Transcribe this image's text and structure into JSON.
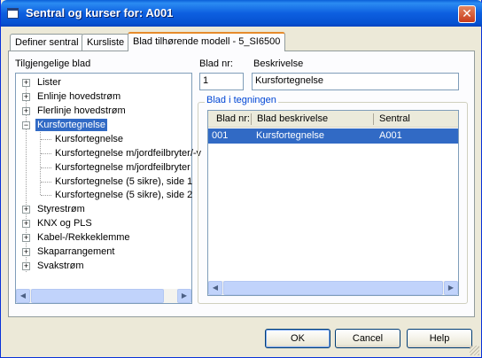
{
  "window": {
    "title": "Sentral og kurser for: A001",
    "close_glyph": "✕"
  },
  "tabs": [
    {
      "label": "Definer sentral"
    },
    {
      "label": "Kursliste"
    },
    {
      "label": "Blad tilhørende modell - 5_SI6500",
      "active": true
    }
  ],
  "left": {
    "label": "Tilgjengelige blad",
    "tree": [
      {
        "label": "Lister",
        "expander": "+"
      },
      {
        "label": "Enlinje hovedstrøm",
        "expander": "+"
      },
      {
        "label": "Flerlinje hovedstrøm",
        "expander": "+"
      },
      {
        "label": "Kursfortegnelse",
        "expander": "−",
        "selected": true
      },
      {
        "label": "Kursfortegnelse",
        "child": true
      },
      {
        "label": "Kursfortegnelse m/jordfeilbryter/-v",
        "child": true
      },
      {
        "label": "Kursfortegnelse m/jordfeilbryter",
        "child": true
      },
      {
        "label": "Kursfortegnelse (5 sikre), side 1",
        "child": true
      },
      {
        "label": "Kursfortegnelse (5 sikre), side 2",
        "child": true
      },
      {
        "label": "Styrestrøm",
        "expander": "+"
      },
      {
        "label": "KNX og PLS",
        "expander": "+"
      },
      {
        "label": "Kabel-/Rekkeklemme",
        "expander": "+"
      },
      {
        "label": "Skaparrangement",
        "expander": "+"
      },
      {
        "label": "Svakstrøm",
        "expander": "+"
      }
    ]
  },
  "right": {
    "blad_nr_label": "Blad nr:",
    "blad_nr_value": "1",
    "beskrivelse_label": "Beskrivelse",
    "beskrivelse_value": "Kursfortegnelse",
    "group_label": "Blad i tegningen",
    "columns": [
      "Blad nr:",
      "Blad beskrivelse",
      "Sentral"
    ],
    "rows": [
      {
        "blad_nr": "001",
        "beskrivelse": "Kursfortegnelse",
        "sentral": "A001"
      }
    ]
  },
  "buttons": {
    "ok": "OK",
    "cancel": "Cancel",
    "help": "Help"
  },
  "icons": {
    "scroll_left": "◀",
    "scroll_right": "▶",
    "scroll_up": "▲",
    "scroll_down": "▼"
  },
  "colors": {
    "titlebar": "#0a5fd8",
    "selection": "#316ac5",
    "tab_accent": "#e68b2c"
  }
}
